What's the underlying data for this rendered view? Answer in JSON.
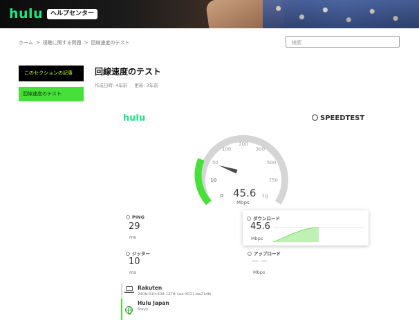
{
  "header": {
    "logo": "hulu",
    "help_center": "ヘルプセンター"
  },
  "breadcrumb": {
    "items": [
      "ホーム",
      "視聴に関する問題",
      "回線速度のテスト"
    ],
    "separator": ">"
  },
  "search": {
    "placeholder": "検索"
  },
  "sidebar": {
    "section_label": "このセクションの記事",
    "items": [
      {
        "label": "回線速度のテスト",
        "active": true
      }
    ]
  },
  "article": {
    "title": "回線速度のテスト",
    "created": "作成日時: 4年前",
    "updated": "更新: 3年前"
  },
  "speedtest": {
    "brand_left": "hulu",
    "brand_right": "SPEEDTEST",
    "gauge": {
      "ticks": [
        "0",
        "10",
        "50",
        "100",
        "200",
        "300",
        "500",
        "750",
        "1g"
      ],
      "value": "45.6",
      "unit": "Mbps",
      "needle_value": 45.6
    },
    "ping": {
      "label": "PING",
      "value": "29",
      "unit": "ms"
    },
    "jitter": {
      "label": "ジッター",
      "value": "10",
      "unit": "ms"
    },
    "download": {
      "label": "ダウンロード",
      "value": "45.6",
      "unit": "Mbps"
    },
    "upload": {
      "label": "アップロード",
      "value": "— —",
      "unit": "Mbps"
    },
    "client": {
      "name": "Rakuten",
      "ip": "240b:010:404:127d:1ea:3021:ee21dfs"
    },
    "server": {
      "name": "Hulu Japan",
      "location": "Tokyo"
    }
  },
  "colors": {
    "brand_green": "#1ce783",
    "accent_green": "#45e038",
    "gauge_track": "#d5d5d5"
  }
}
